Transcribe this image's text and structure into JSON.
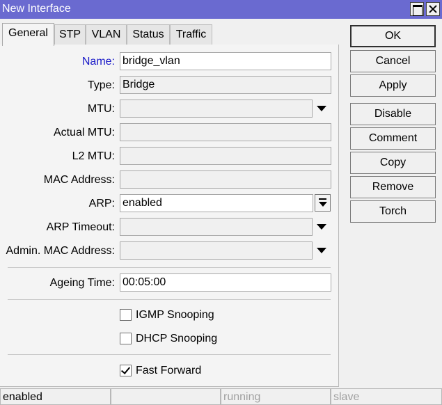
{
  "window": {
    "title": "New Interface"
  },
  "tabs": [
    {
      "label": "General",
      "active": true
    },
    {
      "label": "STP"
    },
    {
      "label": "VLAN"
    },
    {
      "label": "Status"
    },
    {
      "label": "Traffic"
    }
  ],
  "form": {
    "name": {
      "label": "Name:",
      "value": "bridge_vlan"
    },
    "type": {
      "label": "Type:",
      "value": "Bridge"
    },
    "mtu": {
      "label": "MTU:",
      "value": ""
    },
    "actual_mtu": {
      "label": "Actual MTU:",
      "value": ""
    },
    "l2_mtu": {
      "label": "L2 MTU:",
      "value": ""
    },
    "mac_address": {
      "label": "MAC Address:",
      "value": ""
    },
    "arp": {
      "label": "ARP:",
      "value": "enabled"
    },
    "arp_timeout": {
      "label": "ARP Timeout:",
      "value": ""
    },
    "admin_mac": {
      "label": "Admin. MAC Address:",
      "value": ""
    },
    "ageing_time": {
      "label": "Ageing Time:",
      "value": "00:05:00"
    },
    "igmp_snooping": {
      "label": "IGMP Snooping",
      "checked": false
    },
    "dhcp_snooping": {
      "label": "DHCP Snooping",
      "checked": false
    },
    "fast_forward": {
      "label": "Fast Forward",
      "checked": true
    }
  },
  "buttons": {
    "ok": "OK",
    "cancel": "Cancel",
    "apply": "Apply",
    "disable": "Disable",
    "comment": "Comment",
    "copy": "Copy",
    "remove": "Remove",
    "torch": "Torch"
  },
  "status": [
    "enabled",
    "",
    "running",
    "slave"
  ]
}
